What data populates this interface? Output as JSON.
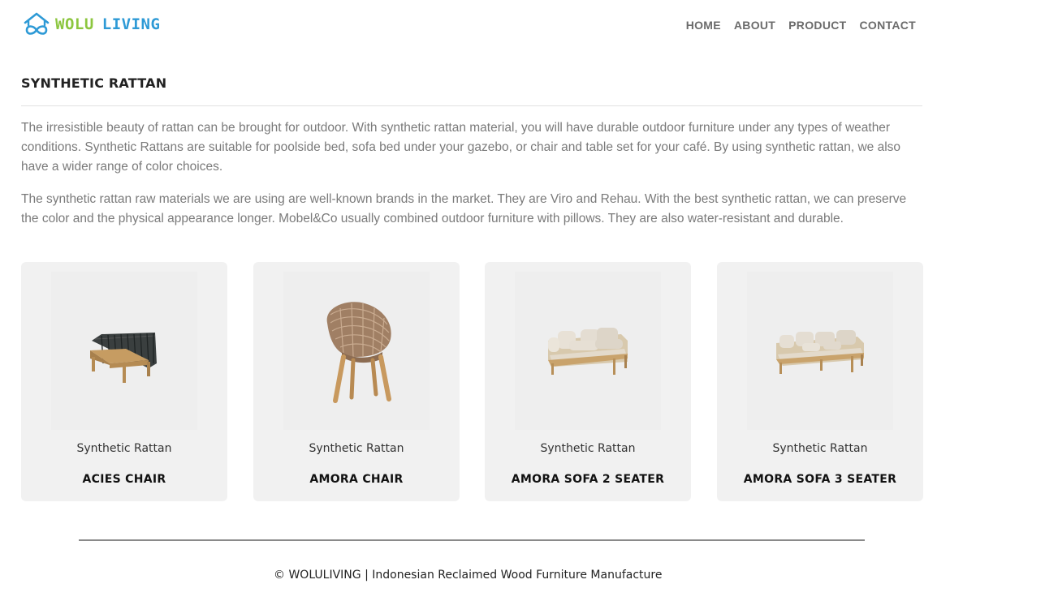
{
  "brand": {
    "logo_word1": "WOLU",
    "logo_word2": "LIVING",
    "color_green": "#8cc63f",
    "color_blue": "#2e9ad6"
  },
  "nav": {
    "items": [
      {
        "label": "HOME"
      },
      {
        "label": "ABOUT"
      },
      {
        "label": "PRODUCT"
      },
      {
        "label": "CONTACT"
      }
    ]
  },
  "page": {
    "title": "SYNTHETIC RATTAN",
    "paragraphs": [
      "The irresistible beauty of rattan can be brought for outdoor. With synthetic rattan material, you will have durable outdoor furniture under any types of weather conditions. Synthetic Rattans are suitable for poolside bed, sofa bed under your gazebo, or chair and table set for your café. By using synthetic rattan, we also have a wider range of color choices.",
      "The synthetic rattan raw materials we are using are well-known brands in the market. They are Viro and Rehau. With the best synthetic rattan, we can preserve the color and the physical appearance longer. Mobel&Co usually combined outdoor furniture with pillows. They are also water-resistant and durable."
    ]
  },
  "products": [
    {
      "category": "Synthetic Rattan",
      "name": "ACIES CHAIR",
      "image": "black-rattan-chair"
    },
    {
      "category": "Synthetic Rattan",
      "name": "AMORA CHAIR",
      "image": "brown-rattan-chair"
    },
    {
      "category": "Synthetic Rattan",
      "name": "AMORA SOFA 2 SEATER",
      "image": "two-seater-sofa"
    },
    {
      "category": "Synthetic Rattan",
      "name": "AMORA SOFA 3 SEATER",
      "image": "three-seater-sofa"
    }
  ],
  "footer": {
    "text": "© WOLULIVING | Indonesian Reclaimed Wood Furniture Manufacture"
  }
}
